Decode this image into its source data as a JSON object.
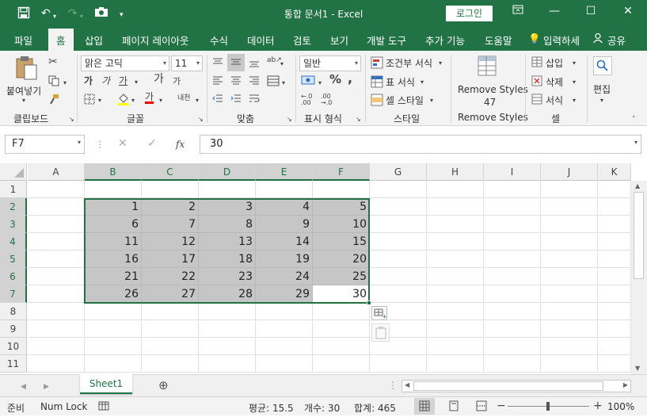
{
  "title_bar": {
    "title": "통합 문서1  -  Excel",
    "login_label": "로그인"
  },
  "tabs": [
    "파일",
    "홈",
    "삽입",
    "페이지 레이아웃",
    "수식",
    "데이터",
    "검토",
    "보기",
    "개발 도구",
    "추가 기능",
    "도움말"
  ],
  "tell_me": "입력하세",
  "share": "공유",
  "ribbon": {
    "clipboard": {
      "paste": "붙여넣기",
      "label": "클립보드"
    },
    "font": {
      "name": "맑은 고딕",
      "size": "11",
      "label": "글꼴",
      "bold": "가",
      "italic": "가",
      "underline": "가",
      "grow": "가",
      "shrink": "가",
      "font_color": "가",
      "phonetic": "내천"
    },
    "alignment": {
      "label": "맞춤"
    },
    "number": {
      "format": "일반",
      "label": "표시 형식"
    },
    "styles": {
      "conditional": "조건부 서식",
      "table": "표 서식",
      "cell": "셀 스타일",
      "label": "스타일"
    },
    "remove_styles": {
      "button": "Remove Styles",
      "count": "47",
      "label": "Remove Styles"
    },
    "cells": {
      "insert": "삽입",
      "delete": "삭제",
      "format": "서식",
      "label": "셀"
    },
    "editing": {
      "label": "편집"
    }
  },
  "formula_bar": {
    "name_box": "F7",
    "fx": "fx",
    "value": "30"
  },
  "columns": [
    "A",
    "B",
    "C",
    "D",
    "E",
    "F",
    "G",
    "H",
    "I",
    "J",
    "K"
  ],
  "rows": [
    "1",
    "2",
    "3",
    "4",
    "5",
    "6",
    "7",
    "8",
    "9",
    "10",
    "11"
  ],
  "cells": [
    [
      "1",
      "2",
      "3",
      "4",
      "5"
    ],
    [
      "6",
      "7",
      "8",
      "9",
      "10"
    ],
    [
      "11",
      "12",
      "13",
      "14",
      "15"
    ],
    [
      "16",
      "17",
      "18",
      "19",
      "20"
    ],
    [
      "21",
      "22",
      "23",
      "24",
      "25"
    ],
    [
      "26",
      "27",
      "28",
      "29",
      "30"
    ]
  ],
  "sheet_tab": "Sheet1",
  "status": {
    "ready": "준비",
    "num_lock": "Num Lock",
    "average": "평균: 15.5",
    "count": "개수: 30",
    "sum": "합계: 465",
    "zoom": "100%"
  }
}
